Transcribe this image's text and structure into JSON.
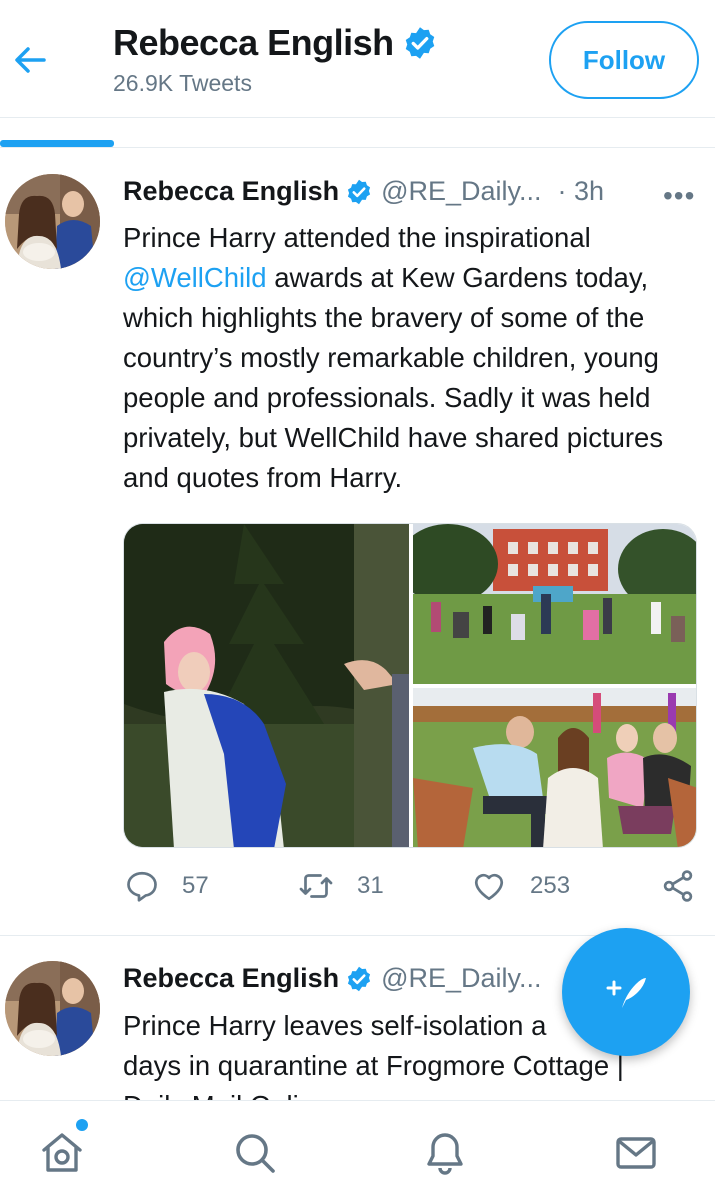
{
  "header": {
    "name": "Rebecca English",
    "tweet_count": "26.9K Tweets",
    "follow_label": "Follow"
  },
  "tweets": [
    {
      "name": "Rebecca English",
      "handle": "@RE_Daily...",
      "time": "· 3h",
      "more": "•••",
      "text_before": "Prince Harry attended the inspirational ",
      "mention": "@WellChild",
      "text_after": " awards at Kew Gardens today, which highlights the bravery of some of the country’s mostly remarkable children, young people and professionals. Sadly it was held privately, but WellChild have shared pictures and quotes from Harry.",
      "replies": "57",
      "retweets": "31",
      "likes": "253"
    },
    {
      "name": "Rebecca English",
      "handle": "@RE_Daily...",
      "text_line1": "Prince Harry leaves self-isolation a",
      "text_line2": "days in quarantine at Frogmore Cottage |",
      "text_line3": "Daily Mail Onli..."
    }
  ],
  "icons": {
    "back": "back-arrow-icon",
    "verified": "verified-badge-icon",
    "reply": "reply-icon",
    "retweet": "retweet-icon",
    "like": "heart-icon",
    "share": "share-icon",
    "compose": "compose-feather-icon",
    "home": "home-icon",
    "search": "search-icon",
    "notifications": "bell-icon",
    "messages": "mail-icon"
  },
  "colors": {
    "accent": "#1da1f2",
    "text": "#14171a",
    "secondary": "#657786"
  }
}
